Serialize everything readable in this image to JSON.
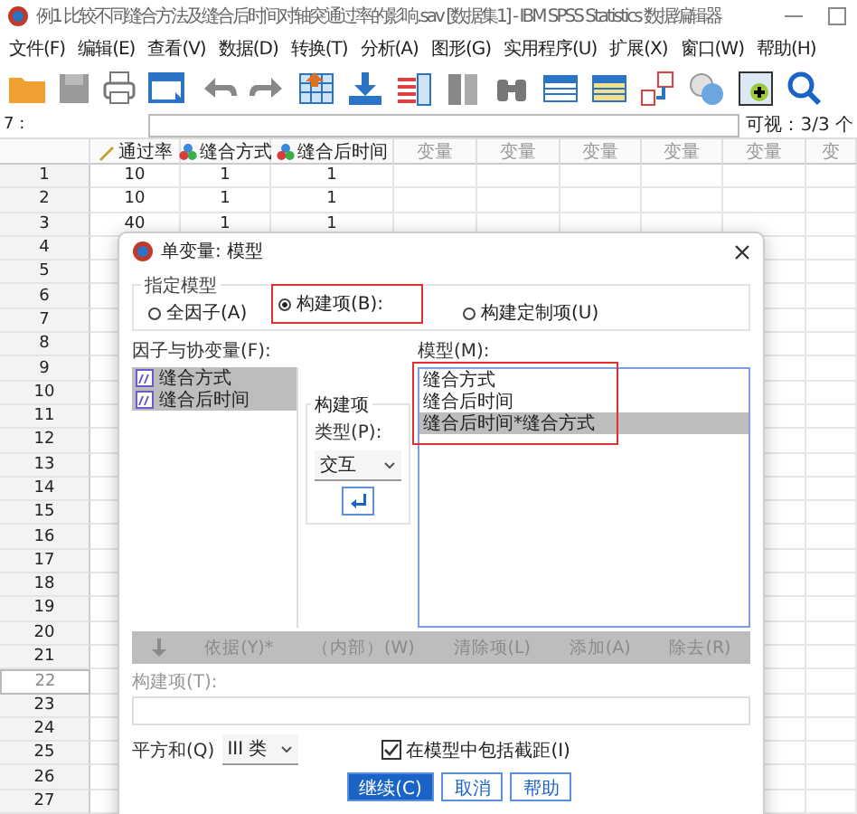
{
  "window": {
    "title": "例1 比较不同缝合方法及缝合后时间对轴突通过率的影响.sav [数据集1] - IBM SPSS Statistics 数据编辑器"
  },
  "menu": [
    "文件(F)",
    "编辑(E)",
    "查看(V)",
    "数据(D)",
    "转换(T)",
    "分析(A)",
    "图形(G)",
    "实用程序(U)",
    "扩展(X)",
    "窗口(W)",
    "帮助(H)"
  ],
  "cell_bar": {
    "ref": "7 :",
    "visible": "可视：3/3 个"
  },
  "columns": [
    {
      "label": "通过率",
      "kind": "scale"
    },
    {
      "label": "缝合方式",
      "kind": "nominal"
    },
    {
      "label": "缝合后时间",
      "kind": "nominal"
    },
    {
      "label": "变量",
      "kind": "empty"
    },
    {
      "label": "变量",
      "kind": "empty"
    },
    {
      "label": "变量",
      "kind": "empty"
    },
    {
      "label": "变量",
      "kind": "empty"
    },
    {
      "label": "变量",
      "kind": "empty"
    },
    {
      "label": "变",
      "kind": "empty"
    }
  ],
  "rows": [
    {
      "num": "1",
      "cells": [
        "10",
        "1",
        "1"
      ],
      "selected": false
    },
    {
      "num": "2",
      "cells": [
        "10",
        "1",
        "1"
      ],
      "selected": false
    },
    {
      "num": "3",
      "cells": [
        "40",
        "1",
        "1"
      ],
      "selected": false
    },
    {
      "num": "4",
      "selected": false
    },
    {
      "num": "5",
      "selected": false
    },
    {
      "num": "6",
      "selected": false
    },
    {
      "num": "7",
      "selected": false
    },
    {
      "num": "8",
      "selected": false
    },
    {
      "num": "9",
      "selected": false
    },
    {
      "num": "10",
      "selected": false
    },
    {
      "num": "11",
      "selected": false
    },
    {
      "num": "12",
      "selected": false
    },
    {
      "num": "13",
      "selected": false
    },
    {
      "num": "14",
      "selected": false
    },
    {
      "num": "15",
      "selected": false
    },
    {
      "num": "16",
      "selected": false
    },
    {
      "num": "17",
      "selected": false
    },
    {
      "num": "18",
      "selected": false
    },
    {
      "num": "19",
      "selected": false
    },
    {
      "num": "20",
      "selected": false
    },
    {
      "num": "21",
      "selected": false
    },
    {
      "num": "22",
      "selected": true
    },
    {
      "num": "23",
      "selected": false
    },
    {
      "num": "24",
      "selected": false
    },
    {
      "num": "25",
      "selected": false
    },
    {
      "num": "26",
      "selected": false
    },
    {
      "num": "27",
      "selected": false
    }
  ],
  "dialog": {
    "title": "单变量: 模型",
    "group_title": "指定模型",
    "radios": [
      {
        "label": "全因子(A)",
        "selected": false,
        "highlighted": false
      },
      {
        "label": "构建项(B):",
        "selected": true,
        "highlighted": true
      },
      {
        "label": "构建定制项(U)",
        "selected": false,
        "highlighted": false
      }
    ],
    "factors": {
      "label": "因子与协变量(F):",
      "items": [
        {
          "label": "缝合方式",
          "selected": true
        },
        {
          "label": "缝合后时间",
          "selected": true
        }
      ]
    },
    "build": {
      "title": "构建项",
      "type_label": "类型(P):",
      "type_value": "交互"
    },
    "model": {
      "label": "模型(M):",
      "highlighted": true,
      "items": [
        {
          "label": "缝合方式",
          "selected": false
        },
        {
          "label": "缝合后时间",
          "selected": false
        },
        {
          "label": "缝合后时间*缝合方式",
          "selected": true
        }
      ]
    },
    "bar_buttons": [
      {
        "kind": "arrow",
        "disabled": true
      },
      {
        "kind": "text",
        "label": "依据(Y)*",
        "disabled": true
      },
      {
        "kind": "text",
        "label": "（内部）(W)",
        "disabled": true
      },
      {
        "kind": "text",
        "label": "清除项(L)",
        "disabled": true
      },
      {
        "kind": "text",
        "label": "添加(A)",
        "disabled": true
      },
      {
        "kind": "text",
        "label": "除去(R)",
        "disabled": true
      }
    ],
    "term_label": "构建项(T):",
    "sum_squares": {
      "label": "平方和(Q)",
      "value": "III 类"
    },
    "intercept": {
      "label": "在模型中包括截距(I)",
      "checked": true
    },
    "buttons": [
      {
        "label": "继续(C)",
        "primary": true
      },
      {
        "label": "取消",
        "primary": false
      },
      {
        "label": "帮助",
        "primary": false
      }
    ]
  }
}
